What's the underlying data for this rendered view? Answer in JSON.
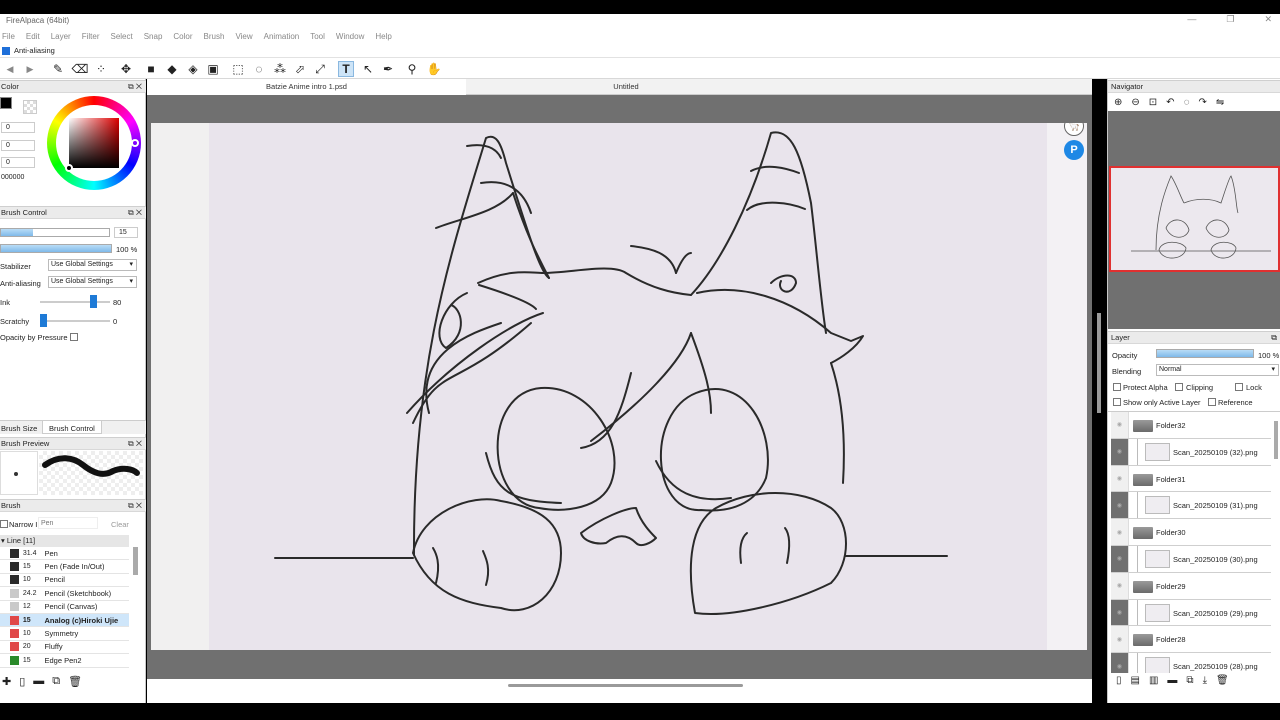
{
  "window": {
    "title": "FireAlpaca (64bit)"
  },
  "menu": [
    "File",
    "Edit",
    "Layer",
    "Filter",
    "Select",
    "Snap",
    "Color",
    "Brush",
    "View",
    "Animation",
    "Tool",
    "Window",
    "Help"
  ],
  "options": {
    "antialias_label": "Anti-aliasing",
    "antialias_checked": true
  },
  "tabs": [
    {
      "label": "Batzie Anime intro 1.psd",
      "active": true
    },
    {
      "label": "Untitled",
      "active": false
    }
  ],
  "color_panel": {
    "title": "Color",
    "values": [
      "0",
      "0",
      "0"
    ],
    "hex": "000000",
    "primary_color": "#000000"
  },
  "brush_control": {
    "title": "Brush Control",
    "size_value": "15",
    "size_fraction": 0.3,
    "opacity_value": "100 %",
    "opacity_fraction": 1.0,
    "stabilizer_label": "Stabilizer",
    "stabilizer_value": "Use Global Settings",
    "antialiasing_label": "Anti-aliasing",
    "antialiasing_value": "Use Global Settings",
    "ink_label": "Ink",
    "ink_value": "80",
    "ink_fraction": 0.8,
    "scratchy_label": "Scratchy",
    "scratchy_value": "0",
    "scratchy_fraction": 0.0,
    "pressure_label": "Opacity by Pressure"
  },
  "panel_tabs": [
    "Brush Size",
    "Brush Control"
  ],
  "brush_preview": {
    "title": "Brush Preview"
  },
  "brush_list": {
    "title": "Brush",
    "narrow_label": "Narrow I",
    "search_placeholder": "Pen",
    "clear_label": "Clear",
    "group_label": "Line [11]",
    "items": [
      {
        "size": "31.4",
        "name": "Pen",
        "color": "#2a2a2a",
        "selected": false
      },
      {
        "size": "15",
        "name": "Pen (Fade In/Out)",
        "color": "#2a2a2a",
        "selected": false
      },
      {
        "size": "10",
        "name": "Pencil",
        "color": "#2a2a2a",
        "selected": false
      },
      {
        "size": "24.2",
        "name": "Pencil (Sketchbook)",
        "color": "#c9c9c9",
        "selected": false
      },
      {
        "size": "12",
        "name": "Pencil (Canvas)",
        "color": "#c9c9c9",
        "selected": false
      },
      {
        "size": "15",
        "name": "Analog (c)Hiroki Ujie",
        "color": "#e04848",
        "selected": true
      },
      {
        "size": "10",
        "name": "Symmetry",
        "color": "#e04848",
        "selected": false
      },
      {
        "size": "20",
        "name": "Fluffy",
        "color": "#e04848",
        "selected": false
      },
      {
        "size": "15",
        "name": "Edge Pen2",
        "color": "#2a8a2a",
        "selected": false
      }
    ]
  },
  "navigator": {
    "title": "Navigator"
  },
  "layer_panel": {
    "title": "Layer",
    "opacity_label": "Opacity",
    "opacity_value": "100 %",
    "opacity_fraction": 1.0,
    "blending_label": "Blending",
    "blending_value": "Normal",
    "protect_alpha": "Protect Alpha",
    "clipping": "Clipping",
    "lock": "Lock",
    "show_active": "Show only Active Layer",
    "reference": "Reference",
    "layers": [
      {
        "type": "folder",
        "name": "Folder32"
      },
      {
        "type": "scan",
        "name": "Scan_20250109 (32).png"
      },
      {
        "type": "folder",
        "name": "Folder31"
      },
      {
        "type": "scan",
        "name": "Scan_20250109 (31).png"
      },
      {
        "type": "folder",
        "name": "Folder30"
      },
      {
        "type": "scan",
        "name": "Scan_20250109 (30).png"
      },
      {
        "type": "folder",
        "name": "Folder29"
      },
      {
        "type": "scan",
        "name": "Scan_20250109 (29).png"
      },
      {
        "type": "folder",
        "name": "Folder28"
      },
      {
        "type": "scan",
        "name": "Scan_20250109 (28).png"
      }
    ]
  }
}
